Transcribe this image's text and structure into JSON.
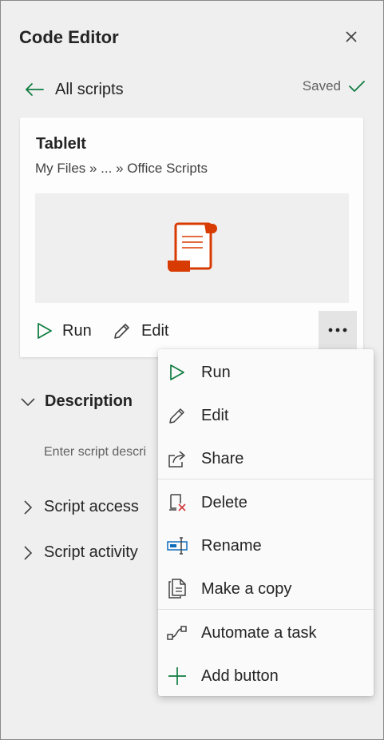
{
  "pane": {
    "title": "Code Editor",
    "back_label": "All scripts",
    "saved_label": "Saved"
  },
  "script_card": {
    "name": "TableIt",
    "path": "My Files » ... » Office Scripts",
    "run_label": "Run",
    "edit_label": "Edit"
  },
  "sections": {
    "description_label": "Description",
    "description_placeholder": "Enter script descri",
    "script_access_label": "Script access",
    "script_activity_label": "Script activity"
  },
  "context_menu": {
    "items": [
      {
        "label": "Run",
        "icon": "run-icon"
      },
      {
        "label": "Edit",
        "icon": "pencil-icon"
      },
      {
        "label": "Share",
        "icon": "share-icon"
      },
      {
        "label": "Delete",
        "icon": "delete-icon"
      },
      {
        "label": "Rename",
        "icon": "rename-icon"
      },
      {
        "label": "Make a copy",
        "icon": "copy-icon"
      },
      {
        "label": "Automate a task",
        "icon": "flow-icon"
      },
      {
        "label": "Add button",
        "icon": "add-icon"
      }
    ]
  },
  "colors": {
    "accent_green": "#107c41",
    "script_icon_orange": "#d83b01"
  }
}
